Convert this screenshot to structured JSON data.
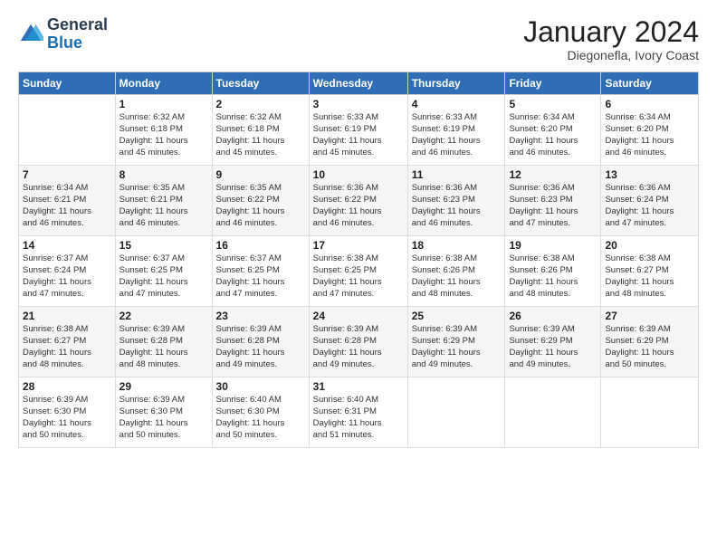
{
  "header": {
    "logo_general": "General",
    "logo_blue": "Blue",
    "month": "January 2024",
    "location": "Diegonefla, Ivory Coast"
  },
  "days_of_week": [
    "Sunday",
    "Monday",
    "Tuesday",
    "Wednesday",
    "Thursday",
    "Friday",
    "Saturday"
  ],
  "weeks": [
    [
      {
        "day": "",
        "info": ""
      },
      {
        "day": "1",
        "info": "Sunrise: 6:32 AM\nSunset: 6:18 PM\nDaylight: 11 hours\nand 45 minutes."
      },
      {
        "day": "2",
        "info": "Sunrise: 6:32 AM\nSunset: 6:18 PM\nDaylight: 11 hours\nand 45 minutes."
      },
      {
        "day": "3",
        "info": "Sunrise: 6:33 AM\nSunset: 6:19 PM\nDaylight: 11 hours\nand 45 minutes."
      },
      {
        "day": "4",
        "info": "Sunrise: 6:33 AM\nSunset: 6:19 PM\nDaylight: 11 hours\nand 46 minutes."
      },
      {
        "day": "5",
        "info": "Sunrise: 6:34 AM\nSunset: 6:20 PM\nDaylight: 11 hours\nand 46 minutes."
      },
      {
        "day": "6",
        "info": "Sunrise: 6:34 AM\nSunset: 6:20 PM\nDaylight: 11 hours\nand 46 minutes."
      }
    ],
    [
      {
        "day": "7",
        "info": "Sunrise: 6:34 AM\nSunset: 6:21 PM\nDaylight: 11 hours\nand 46 minutes."
      },
      {
        "day": "8",
        "info": "Sunrise: 6:35 AM\nSunset: 6:21 PM\nDaylight: 11 hours\nand 46 minutes."
      },
      {
        "day": "9",
        "info": "Sunrise: 6:35 AM\nSunset: 6:22 PM\nDaylight: 11 hours\nand 46 minutes."
      },
      {
        "day": "10",
        "info": "Sunrise: 6:36 AM\nSunset: 6:22 PM\nDaylight: 11 hours\nand 46 minutes."
      },
      {
        "day": "11",
        "info": "Sunrise: 6:36 AM\nSunset: 6:23 PM\nDaylight: 11 hours\nand 46 minutes."
      },
      {
        "day": "12",
        "info": "Sunrise: 6:36 AM\nSunset: 6:23 PM\nDaylight: 11 hours\nand 47 minutes."
      },
      {
        "day": "13",
        "info": "Sunrise: 6:36 AM\nSunset: 6:24 PM\nDaylight: 11 hours\nand 47 minutes."
      }
    ],
    [
      {
        "day": "14",
        "info": "Sunrise: 6:37 AM\nSunset: 6:24 PM\nDaylight: 11 hours\nand 47 minutes."
      },
      {
        "day": "15",
        "info": "Sunrise: 6:37 AM\nSunset: 6:25 PM\nDaylight: 11 hours\nand 47 minutes."
      },
      {
        "day": "16",
        "info": "Sunrise: 6:37 AM\nSunset: 6:25 PM\nDaylight: 11 hours\nand 47 minutes."
      },
      {
        "day": "17",
        "info": "Sunrise: 6:38 AM\nSunset: 6:25 PM\nDaylight: 11 hours\nand 47 minutes."
      },
      {
        "day": "18",
        "info": "Sunrise: 6:38 AM\nSunset: 6:26 PM\nDaylight: 11 hours\nand 48 minutes."
      },
      {
        "day": "19",
        "info": "Sunrise: 6:38 AM\nSunset: 6:26 PM\nDaylight: 11 hours\nand 48 minutes."
      },
      {
        "day": "20",
        "info": "Sunrise: 6:38 AM\nSunset: 6:27 PM\nDaylight: 11 hours\nand 48 minutes."
      }
    ],
    [
      {
        "day": "21",
        "info": "Sunrise: 6:38 AM\nSunset: 6:27 PM\nDaylight: 11 hours\nand 48 minutes."
      },
      {
        "day": "22",
        "info": "Sunrise: 6:39 AM\nSunset: 6:28 PM\nDaylight: 11 hours\nand 48 minutes."
      },
      {
        "day": "23",
        "info": "Sunrise: 6:39 AM\nSunset: 6:28 PM\nDaylight: 11 hours\nand 49 minutes."
      },
      {
        "day": "24",
        "info": "Sunrise: 6:39 AM\nSunset: 6:28 PM\nDaylight: 11 hours\nand 49 minutes."
      },
      {
        "day": "25",
        "info": "Sunrise: 6:39 AM\nSunset: 6:29 PM\nDaylight: 11 hours\nand 49 minutes."
      },
      {
        "day": "26",
        "info": "Sunrise: 6:39 AM\nSunset: 6:29 PM\nDaylight: 11 hours\nand 49 minutes."
      },
      {
        "day": "27",
        "info": "Sunrise: 6:39 AM\nSunset: 6:29 PM\nDaylight: 11 hours\nand 50 minutes."
      }
    ],
    [
      {
        "day": "28",
        "info": "Sunrise: 6:39 AM\nSunset: 6:30 PM\nDaylight: 11 hours\nand 50 minutes."
      },
      {
        "day": "29",
        "info": "Sunrise: 6:39 AM\nSunset: 6:30 PM\nDaylight: 11 hours\nand 50 minutes."
      },
      {
        "day": "30",
        "info": "Sunrise: 6:40 AM\nSunset: 6:30 PM\nDaylight: 11 hours\nand 50 minutes."
      },
      {
        "day": "31",
        "info": "Sunrise: 6:40 AM\nSunset: 6:31 PM\nDaylight: 11 hours\nand 51 minutes."
      },
      {
        "day": "",
        "info": ""
      },
      {
        "day": "",
        "info": ""
      },
      {
        "day": "",
        "info": ""
      }
    ]
  ]
}
